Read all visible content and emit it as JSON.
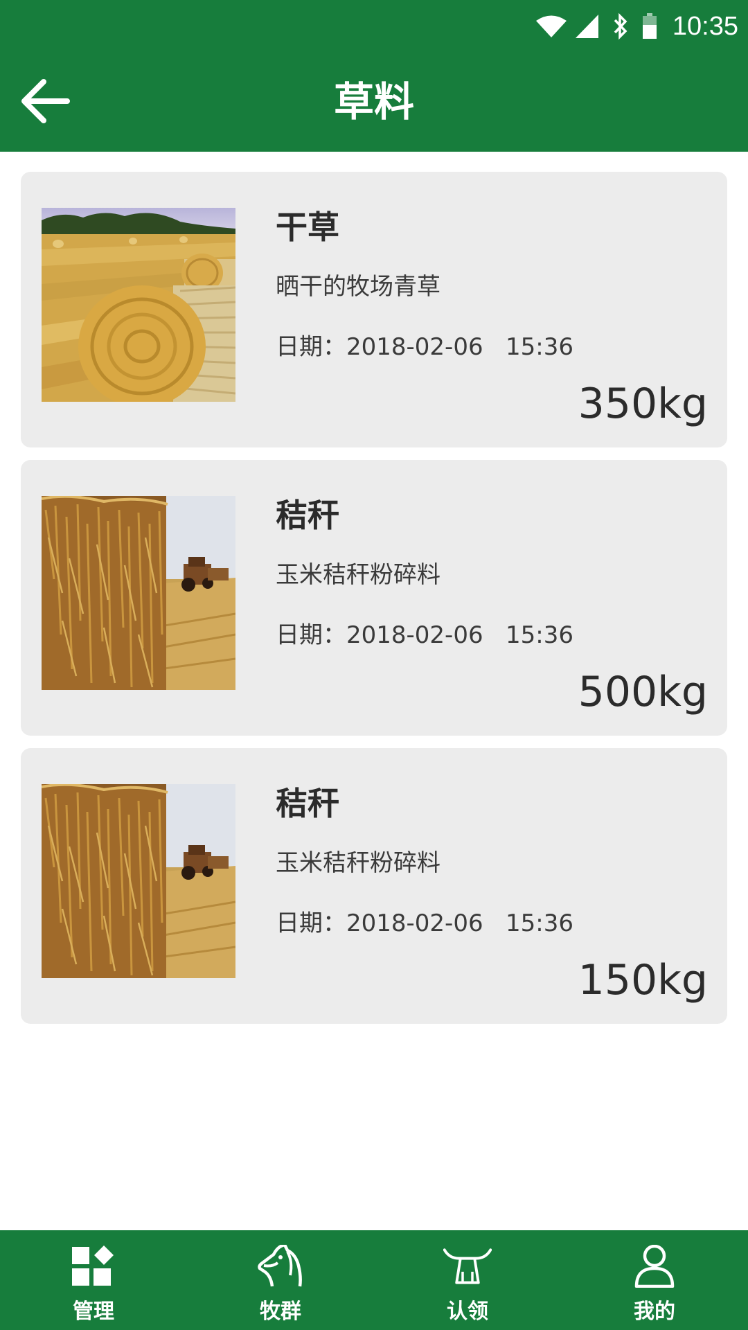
{
  "status_bar": {
    "time": "10:35",
    "icons": [
      "wifi-icon",
      "signal-icon",
      "bluetooth-icon",
      "battery-icon"
    ]
  },
  "app_bar": {
    "title": "草料",
    "back_icon": "arrow-left-icon"
  },
  "colors": {
    "brand_green": "#177d3c",
    "card_bg": "#ececec"
  },
  "items": [
    {
      "name": "干草",
      "description": "晒干的牧场青草",
      "date": "日期：2018-02-06   15:36",
      "weight": "350kg",
      "image": "hay-bales"
    },
    {
      "name": "秸秆",
      "description": "玉米秸秆粉碎料",
      "date": "日期：2018-02-06   15:36",
      "weight": "500kg",
      "image": "straw-bale-tractor"
    },
    {
      "name": "秸秆",
      "description": "玉米秸秆粉碎料",
      "date": "日期：2018-02-06   15:36",
      "weight": "150kg",
      "image": "straw-bale-tractor"
    }
  ],
  "bottom_nav": [
    {
      "label": "管理",
      "icon": "grid-manage-icon"
    },
    {
      "label": "牧群",
      "icon": "horse-icon"
    },
    {
      "label": "认领",
      "icon": "claim-icon"
    },
    {
      "label": "我的",
      "icon": "person-icon"
    }
  ]
}
